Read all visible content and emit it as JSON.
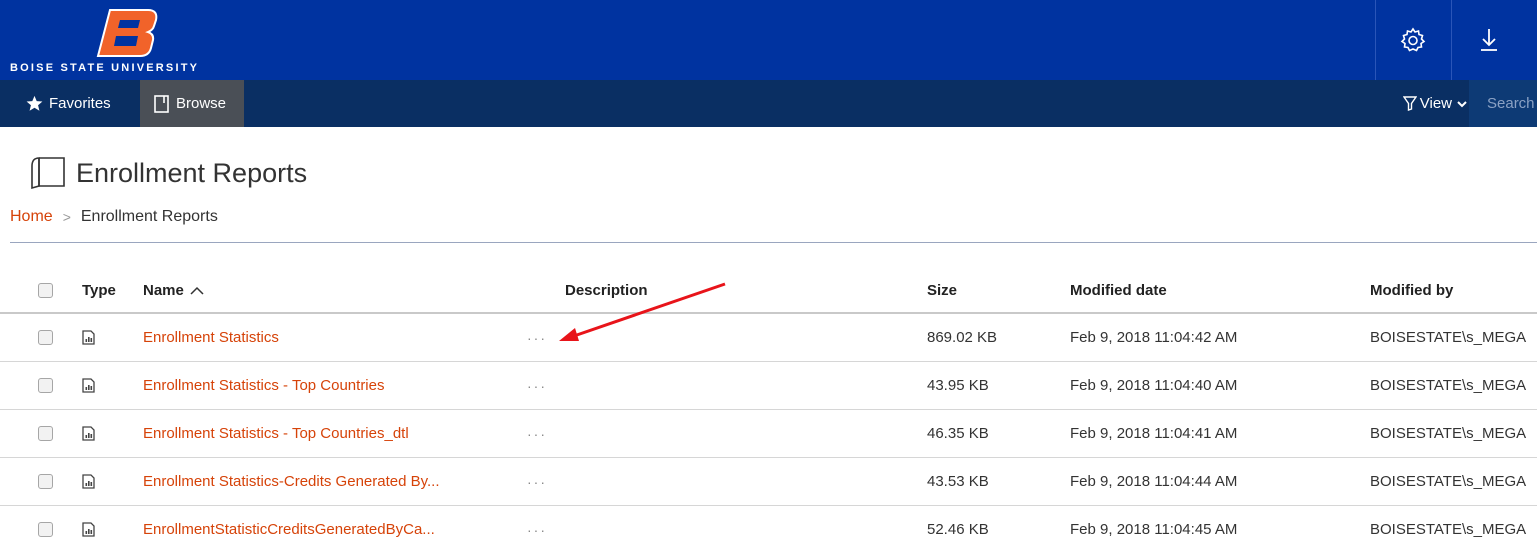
{
  "brand": {
    "logo_text": "BOISE STATE UNIVERSITY",
    "primary_color": "#0033a0",
    "accent_color": "#d64309",
    "nav_color": "#0a2f63"
  },
  "header": {
    "settings_icon": "gear-icon",
    "download_icon": "download-arrow-icon"
  },
  "nav": {
    "favorites_label": "Favorites",
    "browse_label": "Browse",
    "view_label": "View",
    "search_placeholder": "Search"
  },
  "page": {
    "title": "Enrollment Reports",
    "breadcrumb": {
      "home": "Home",
      "separator": ">",
      "current": "Enrollment Reports"
    }
  },
  "table": {
    "columns": {
      "type": "Type",
      "name": "Name",
      "description": "Description",
      "size": "Size",
      "modified_date": "Modified date",
      "modified_by": "Modified by"
    },
    "sort": {
      "column": "name",
      "direction": "ascending"
    },
    "rows": [
      {
        "name": "Enrollment Statistics",
        "description": "···",
        "size": "869.02 KB",
        "modified_date": "Feb 9, 2018 11:04:42 AM",
        "modified_by": "BOISESTATE\\s_MEGA"
      },
      {
        "name": "Enrollment Statistics - Top Countries",
        "description": "···",
        "size": "43.95 KB",
        "modified_date": "Feb 9, 2018 11:04:40 AM",
        "modified_by": "BOISESTATE\\s_MEGA"
      },
      {
        "name": "Enrollment Statistics - Top Countries_dtl",
        "description": "···",
        "size": "46.35 KB",
        "modified_date": "Feb 9, 2018 11:04:41 AM",
        "modified_by": "BOISESTATE\\s_MEGA"
      },
      {
        "name": "Enrollment Statistics-Credits Generated By...",
        "description": "···",
        "size": "43.53 KB",
        "modified_date": "Feb 9, 2018 11:04:44 AM",
        "modified_by": "BOISESTATE\\s_MEGA"
      },
      {
        "name": "EnrollmentStatisticCreditsGeneratedByCa...",
        "description": "···",
        "size": "52.46 KB",
        "modified_date": "Feb 9, 2018 11:04:45 AM",
        "modified_by": "BOISESTATE\\s_MEGA"
      }
    ]
  },
  "annotation": {
    "color": "#e8141a"
  }
}
